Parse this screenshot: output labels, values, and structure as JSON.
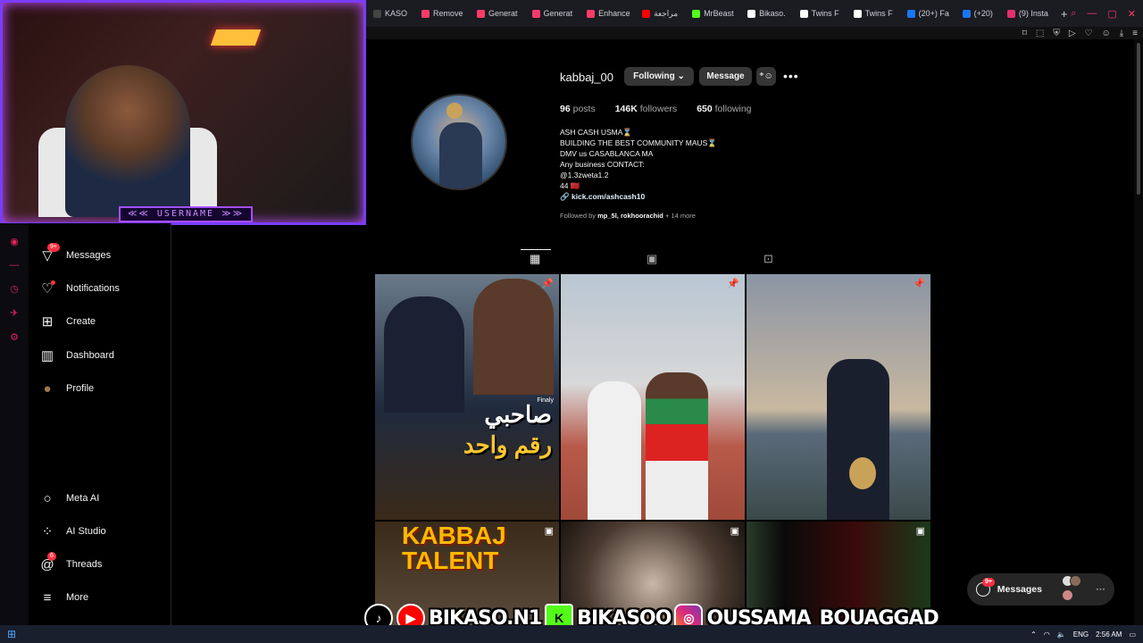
{
  "browser": {
    "tabs": [
      {
        "label": "KASO",
        "color": "#444"
      },
      {
        "label": "Remove",
        "color": "#ff3a6a"
      },
      {
        "label": "Generat",
        "color": "#ff3a6a"
      },
      {
        "label": "Generat",
        "color": "#ff3a6a"
      },
      {
        "label": "Enhance",
        "color": "#ff3a6a"
      },
      {
        "label": "مراجعة",
        "color": "#ff0000"
      },
      {
        "label": "MrBeast",
        "color": "#53fc18"
      },
      {
        "label": "Bikaso.",
        "color": "#fff"
      },
      {
        "label": "Twins F",
        "color": "#fff"
      },
      {
        "label": "Twins F",
        "color": "#fff"
      },
      {
        "label": "(20+) Fa",
        "color": "#1877f2"
      },
      {
        "label": "(+20)",
        "color": "#1877f2"
      },
      {
        "label": "(9) Insta",
        "color": "#e1306c"
      }
    ],
    "new_tab": "+"
  },
  "webcam": {
    "username_label": "≪≪ USERNAME ≫≫"
  },
  "nav": {
    "items": [
      {
        "label": "Messages",
        "icon": "send-icon",
        "badge": "9+"
      },
      {
        "label": "Notifications",
        "icon": "heart-icon",
        "badge": ""
      },
      {
        "label": "Create",
        "icon": "plus-square-icon",
        "badge": ""
      },
      {
        "label": "Dashboard",
        "icon": "chart-icon",
        "badge": ""
      },
      {
        "label": "Profile",
        "icon": "avatar-icon",
        "badge": ""
      },
      {
        "label": "Meta AI",
        "icon": "ring-icon",
        "badge": ""
      },
      {
        "label": "AI Studio",
        "icon": "grid-dots-icon",
        "badge": ""
      },
      {
        "label": "Threads",
        "icon": "threads-icon",
        "badge": "6"
      },
      {
        "label": "More",
        "icon": "menu-icon",
        "badge": ""
      }
    ]
  },
  "profile": {
    "username": "kabbaj_00",
    "following_btn": "Following ⌄",
    "message_btn": "Message",
    "posts": "96",
    "posts_label": "posts",
    "followers": "146K",
    "followers_label": "followers",
    "following": "650",
    "following_label": "following",
    "bio_lines": [
      "ASH CASH USMA⌛",
      "BUILDING THE BEST COMMUNITY MAUS⌛",
      "DMV us CASABLANCA MA",
      "Any business CONTACT:",
      "@1.3zweta1.2",
      "44 🇲🇦"
    ],
    "link": "kick.com/ashcash10",
    "followed_by_prefix": "Followed by",
    "followed_by_names": "mp_5l, rokhoorachid",
    "followed_by_suffix": "+ 14 more"
  },
  "posts": [
    {
      "caption_line1": "صاحبي",
      "caption_line2": "رقم واحد",
      "tag": "Finaly"
    },
    {
      "caption_line1": "KABBAJ",
      "caption_line2": "TALENT"
    }
  ],
  "messages_popup": {
    "label": "Messages",
    "badge": "9+"
  },
  "overlay": {
    "tiktok": "♪",
    "youtube": "▶",
    "yt_name": "BIKASO.N1",
    "kick": "K",
    "kick_name": "BIKASOO",
    "ig_name": "OUSSAMA_BOUAGGAD"
  },
  "taskbar": {
    "lang": "ENG",
    "time": "2:56 AM"
  }
}
